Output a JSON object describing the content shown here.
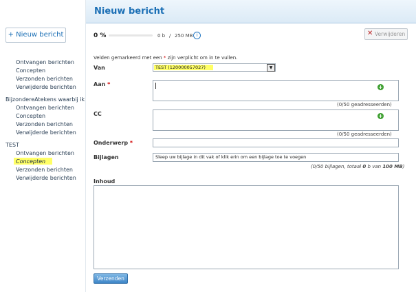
{
  "header": {
    "title": "Nieuw bericht"
  },
  "sidebar": {
    "new_button": "+ Nieuw bericht",
    "groups": [
      {
        "name": "",
        "items": [
          "Ontvangen berichten",
          "Concepten",
          "Verzonden berichten",
          "Verwijderde berichten"
        ]
      },
      {
        "name": "BijzondereAtekens waarbij ik de n...",
        "items": [
          "Ontvangen berichten",
          "Concepten",
          "Verzonden berichten",
          "Verwijderde berichten"
        ]
      },
      {
        "name": "TEST",
        "items": [
          "Ontvangen berichten",
          "Concepten",
          "Verzonden berichten",
          "Verwijderde berichten"
        ],
        "active": "Concepten"
      }
    ]
  },
  "quota": {
    "percent": "0 %",
    "used": "0 b",
    "sep": "/",
    "total": "250 MB",
    "fill": 0
  },
  "toolbar": {
    "delete_label": "Verwijderen"
  },
  "form": {
    "required_note_pre": "Velden gemarkeerd met een",
    "required_note_post": "zijn verplicht om in te vullen.",
    "star": "*",
    "van_label": "Van",
    "van_value": "TEST (120000057027)",
    "aan_label": "Aan",
    "aan_count": "(0/50 geadresseerden)",
    "cc_label": "CC",
    "cc_count": "(0/50 geadresseerden)",
    "onderwerp_label": "Onderwerp",
    "bijlagen_label": "Bijlagen",
    "bijlagen_hint": "Sleep uw bijlage in dit vak of klik erin om een bijlage toe te voegen",
    "bijlagen_info_pre": "(0/50 bijlagen, totaal",
    "bijlagen_info_used": "0",
    "bijlagen_info_mid": "b van",
    "bijlagen_info_total": "100 MB",
    "bijlagen_info_end": ")",
    "inhoud_label": "Inhoud",
    "send_label": "Verzenden"
  },
  "colors": {
    "accent": "#1b6fb5",
    "highlight": "#ffff66",
    "add": "#3fa032"
  }
}
